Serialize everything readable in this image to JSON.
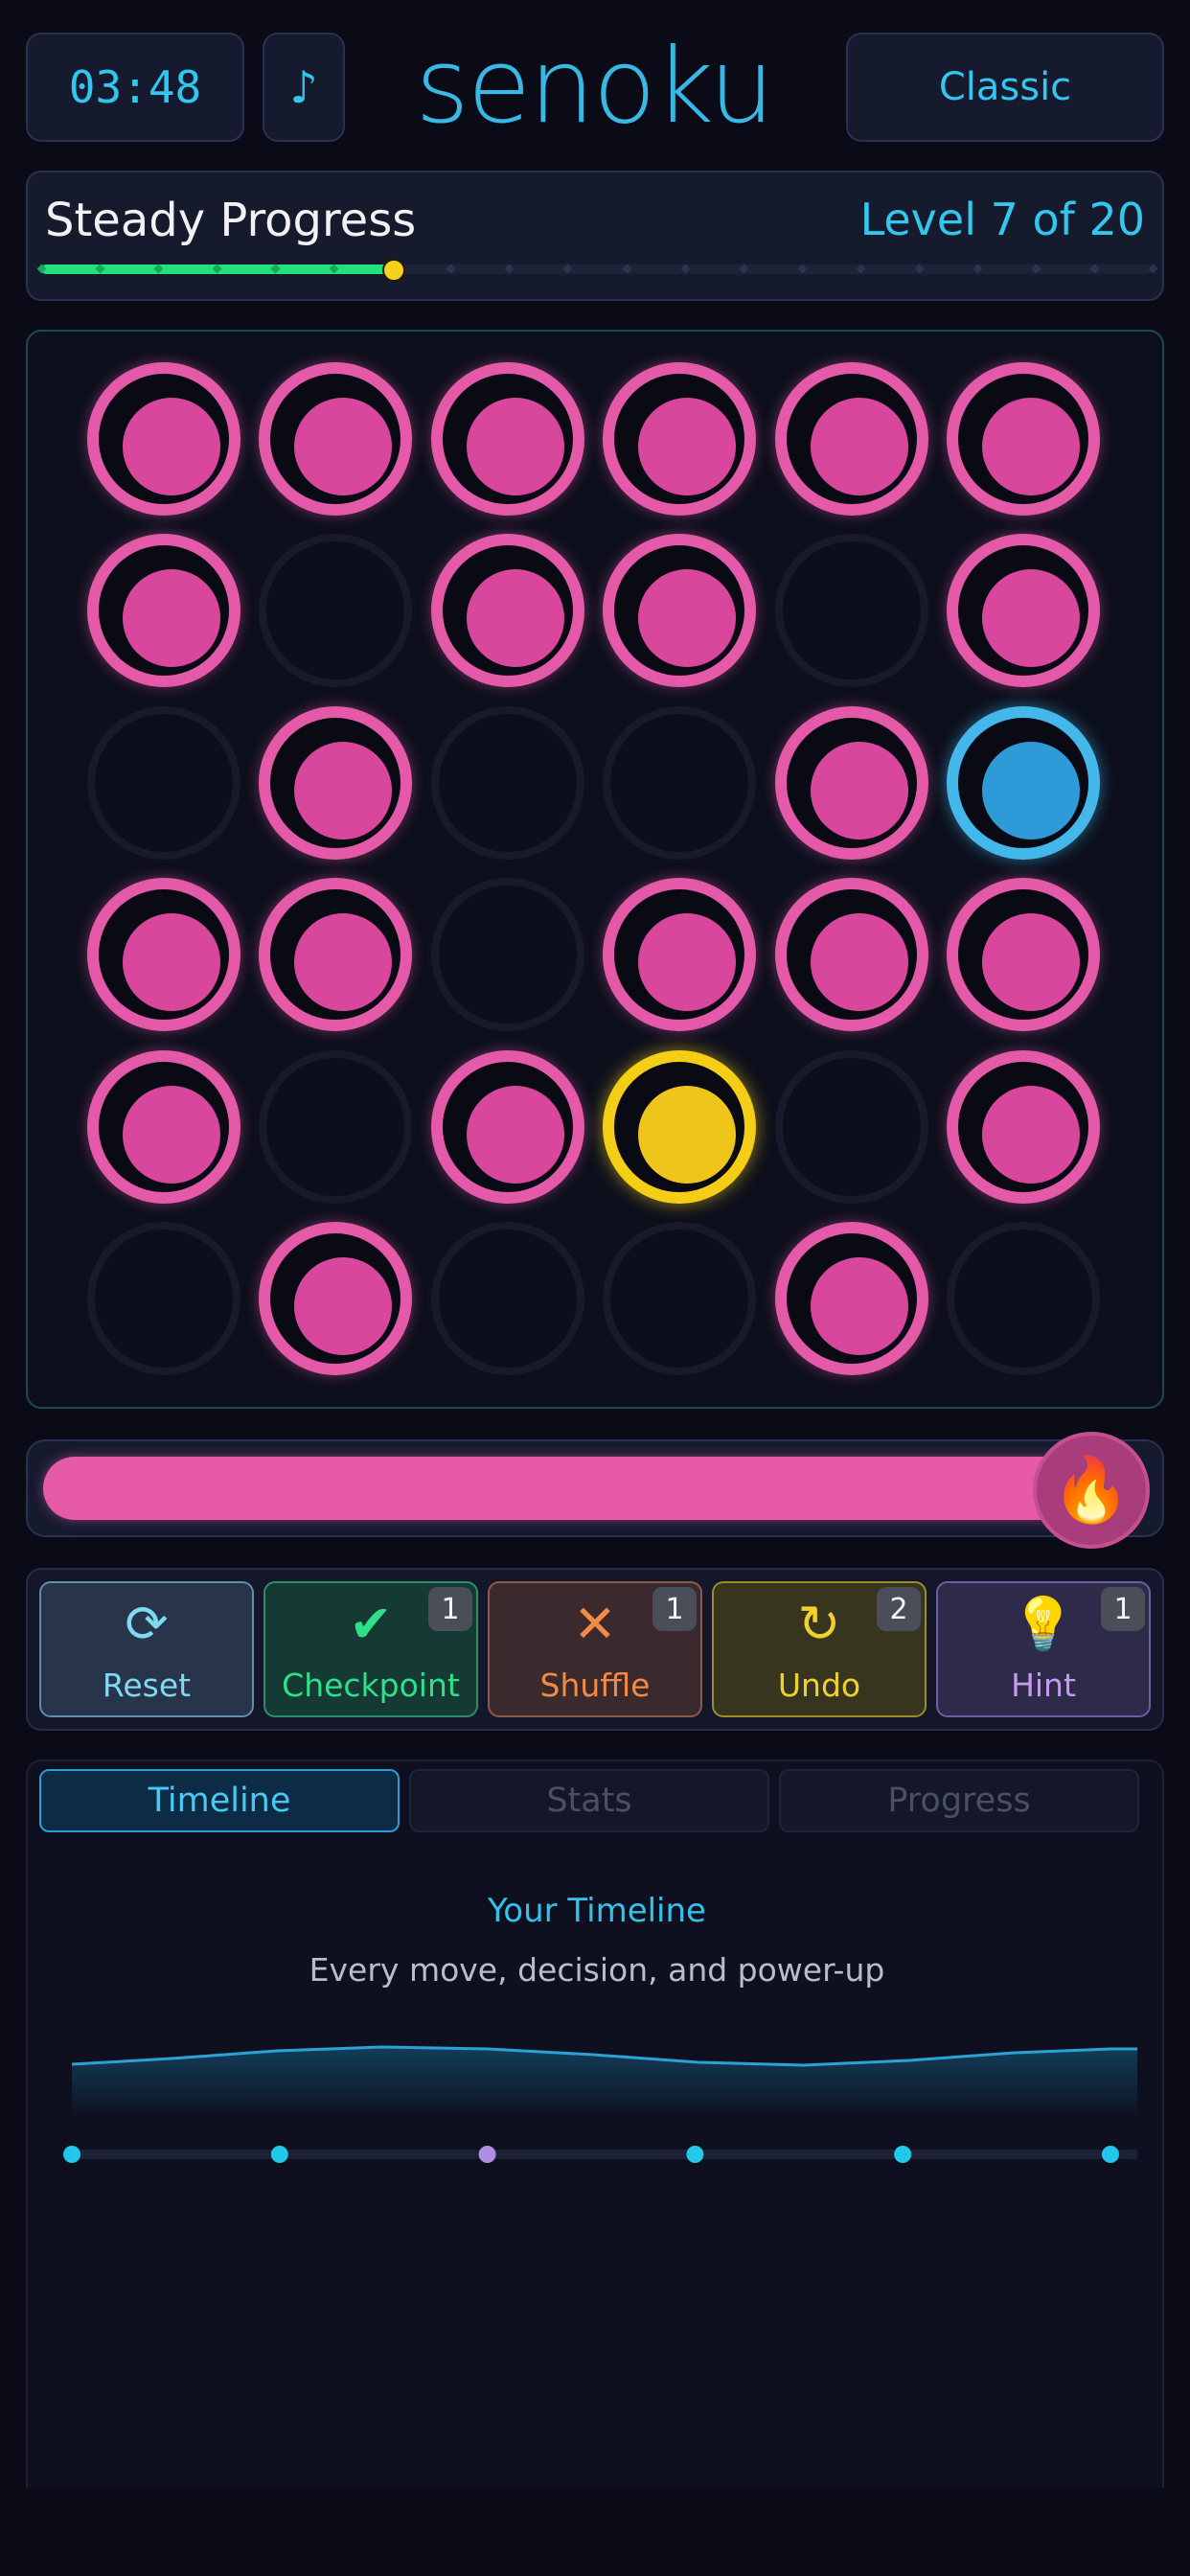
{
  "header": {
    "timer": "03:48",
    "music_icon": "music-note-icon",
    "music_glyph": "♪",
    "logo": "senoku",
    "mode": "Classic"
  },
  "level": {
    "name": "Steady Progress",
    "count": "Level 7 of 20",
    "current": 7,
    "total": 20
  },
  "board": {
    "rows": 6,
    "cols": 6,
    "cells": [
      [
        "pink",
        "pink",
        "pink",
        "pink",
        "pink",
        "pink"
      ],
      [
        "pink",
        "empty",
        "pink",
        "pink",
        "empty",
        "pink"
      ],
      [
        "empty",
        "pink",
        "empty",
        "empty",
        "pink",
        "blue"
      ],
      [
        "pink",
        "pink",
        "empty",
        "pink",
        "pink",
        "pink"
      ],
      [
        "pink",
        "empty",
        "pink",
        "yellow",
        "empty",
        "pink"
      ],
      [
        "empty",
        "pink",
        "empty",
        "empty",
        "pink",
        "empty"
      ]
    ],
    "colors": {
      "pink": "#e55aa8",
      "blue": "#44b8ea",
      "yellow": "#f4cd16"
    }
  },
  "energy": {
    "fill": 1.0,
    "icon": "flame-icon",
    "glyph": "🔥"
  },
  "tools": [
    {
      "label": "Reset",
      "icon": "refresh-icon",
      "glyph": "⟳",
      "badge": "",
      "color": "#7fd9f2",
      "bg": "#273449",
      "border": "#5d8fa8"
    },
    {
      "label": "Checkpoint",
      "icon": "checkpoint-pin-icon",
      "glyph": "✔",
      "badge": "1",
      "color": "#2fe08a",
      "bg": "#143a33",
      "border": "#2d8f68"
    },
    {
      "label": "Shuffle",
      "icon": "shuffle-icon",
      "glyph": "✕",
      "badge": "1",
      "color": "#f08a44",
      "bg": "#3a2a2e",
      "border": "#8f5a44"
    },
    {
      "label": "Undo",
      "icon": "undo-icon",
      "glyph": "↻",
      "badge": "2",
      "color": "#f0d02a",
      "bg": "#38351f",
      "border": "#9c8b2a"
    },
    {
      "label": "Hint",
      "icon": "lightbulb-icon",
      "glyph": "💡",
      "badge": "1",
      "color": "#c79af2",
      "bg": "#2d2a4a",
      "border": "#6c5ea0"
    }
  ],
  "tabs": [
    {
      "label": "Timeline",
      "active": true
    },
    {
      "label": "Stats",
      "active": false
    },
    {
      "label": "Progress",
      "active": false
    }
  ],
  "timeline": {
    "title": "Your Timeline",
    "subtitle": "Every move, decision, and power-up",
    "events": [
      {
        "kind": "move",
        "color": "#22c8ea"
      },
      {
        "kind": "move",
        "color": "#22c8ea"
      },
      {
        "kind": "power-up",
        "color": "#b08ee6"
      },
      {
        "kind": "move",
        "color": "#22c8ea"
      },
      {
        "kind": "move",
        "color": "#22c8ea"
      },
      {
        "kind": "move",
        "color": "#22c8ea"
      }
    ]
  }
}
